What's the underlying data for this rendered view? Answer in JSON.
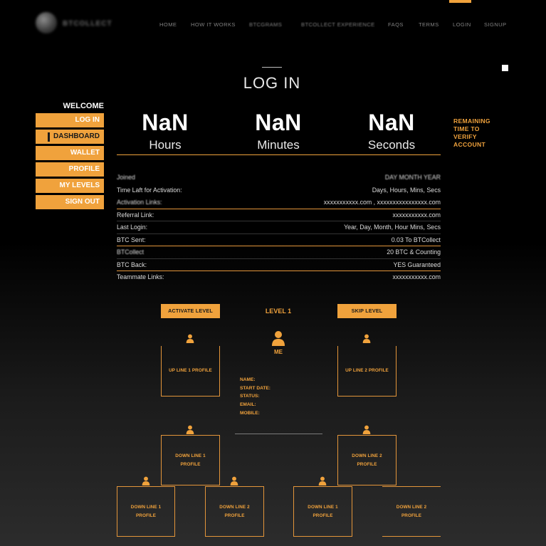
{
  "header": {
    "logo_text": "BTCOLLECT",
    "nav": [
      {
        "label": "HOME",
        "active": false
      },
      {
        "label": "HOW IT WORKS",
        "active": false
      },
      {
        "label": "BTCGRAMS",
        "active": false
      },
      {
        "label": "BTCOLLECT EXPERIENCE",
        "active": false
      },
      {
        "label": "FAQS",
        "active": false
      },
      {
        "label": "TERMS",
        "active": false
      },
      {
        "label": "LOGIN",
        "active": true
      },
      {
        "label": "SIGNUP",
        "active": false
      }
    ]
  },
  "page": {
    "title": "LOG IN"
  },
  "sidebar": {
    "welcome": "WELCOME",
    "items": [
      {
        "label": "LOG IN",
        "active": false
      },
      {
        "label": "DASHBOARD",
        "active": true
      },
      {
        "label": "WALLET",
        "active": false
      },
      {
        "label": "PROFILE",
        "active": false
      },
      {
        "label": "MY LEVELS",
        "active": false
      },
      {
        "label": "SIGN OUT",
        "active": false
      }
    ]
  },
  "countdown": {
    "units": [
      {
        "value": "NaN",
        "label": "Hours"
      },
      {
        "value": "NaN",
        "label": "Minutes"
      },
      {
        "value": "NaN",
        "label": "Seconds"
      }
    ],
    "note_lines": [
      "REMAINING",
      "TIME TO",
      "VERIFY",
      "ACCOUNT"
    ]
  },
  "info_rows": [
    {
      "label": "Joined",
      "value": "DAY MONTH YEAR"
    },
    {
      "label": "Time Laft for Activation:",
      "value": "Days, Hours, Mins, Secs"
    },
    {
      "label": "Activation Links:",
      "value": "xxxxxxxxxxx.com , xxxxxxxxxxxxxxxx.com"
    },
    {
      "label": "Referral Link:",
      "value": "xxxxxxxxxxx.com"
    },
    {
      "label": "Last Login:",
      "value": "Year, Day, Month, Hour Mins, Secs"
    },
    {
      "label": "BTC Sent:",
      "value": "0.03 To BTCollect"
    },
    {
      "label": "BTCollect",
      "value": "20 BTC & Counting"
    },
    {
      "label": "BTC Back:",
      "value": "YES Guaranteed"
    },
    {
      "label": "Teammate Links:",
      "value": "xxxxxxxxxxx.com"
    }
  ],
  "levels": {
    "activate_label": "ACTIVATE LEVEL",
    "level_title": "LEVEL 1",
    "skip_label": "SKIP LEVEL",
    "me_label": "ME",
    "profile_fields": [
      "NAME:",
      "START DATE:",
      "STATUS:",
      "EMAIL:",
      "MOBILE:"
    ],
    "upline": [
      {
        "label": "UP LINE 1 PROFILE"
      },
      {
        "label": "UP LINE 2 PROFILE"
      }
    ],
    "downline_tier1": [
      {
        "lines": [
          "DOWN LINE 1",
          "PROFILE"
        ]
      },
      {
        "lines": [
          "DOWN LINE 2",
          "PROFILE"
        ]
      }
    ],
    "downline_tier2": [
      {
        "lines": [
          "DOWN LINE 1",
          "PROFILE"
        ]
      },
      {
        "lines": [
          "DOWN LINE 2",
          "PROFILE"
        ]
      },
      {
        "lines": [
          "DOWN LINE 1",
          "PROFILE"
        ]
      },
      {
        "lines": [
          "DOWN LINE 2",
          "PROFILE"
        ]
      }
    ]
  },
  "colors": {
    "accent": "#f0a23c",
    "background": "#000000",
    "button_text": "#1a1a1a",
    "nav_text": "#808080",
    "body_text": "#dcdcdc"
  },
  "icons": {
    "user": "user-icon",
    "logo": "logo-mark-icon"
  }
}
